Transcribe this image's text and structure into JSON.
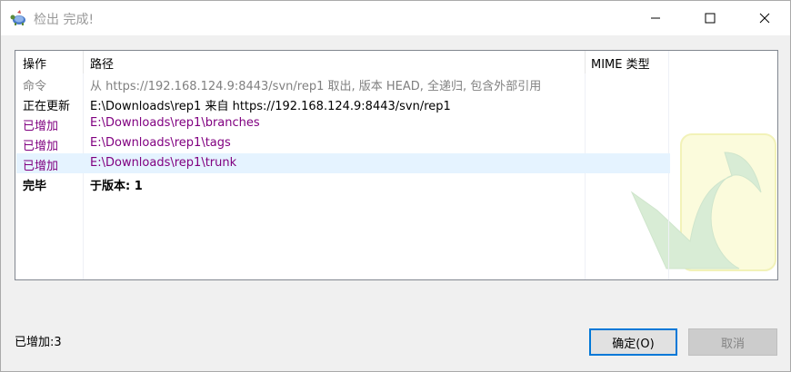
{
  "window": {
    "title": "检出 完成!",
    "app_icon": "tortoisesvn-icon",
    "controls": [
      "minimize-icon",
      "maximize-icon",
      "close-icon"
    ]
  },
  "list": {
    "columns": [
      "操作",
      "路径",
      "MIME 类型"
    ],
    "rows": [
      {
        "action": "命令",
        "path": "从 https://192.168.124.9:8443/svn/rep1 取出, 版本 HEAD, 全递归, 包含外部引用",
        "mime": "",
        "kind": "command",
        "color": "#808080"
      },
      {
        "action": "正在更新",
        "path": "E:\\Downloads\\rep1 来自 https://192.168.124.9:8443/svn/rep1",
        "mime": "",
        "kind": "update",
        "color": "#000000"
      },
      {
        "action": "已增加",
        "path": "E:\\Downloads\\rep1\\branches",
        "mime": "",
        "kind": "added",
        "color": "#800080"
      },
      {
        "action": "已增加",
        "path": "E:\\Downloads\\rep1\\tags",
        "mime": "",
        "kind": "added",
        "color": "#800080"
      },
      {
        "action": "已增加",
        "path": "E:\\Downloads\\rep1\\trunk",
        "mime": "",
        "kind": "added",
        "color": "#800080",
        "selected": true
      },
      {
        "action": "完毕",
        "path": "于版本: 1",
        "mime": "",
        "kind": "done",
        "color": "#000000"
      }
    ]
  },
  "status": {
    "text": "已增加:3"
  },
  "buttons": {
    "ok": "确定(O)",
    "cancel": "取消"
  },
  "colors": {
    "accent": "#0078d7",
    "selected_row": "#e5f3ff",
    "added": "#800080",
    "command": "#808080"
  }
}
